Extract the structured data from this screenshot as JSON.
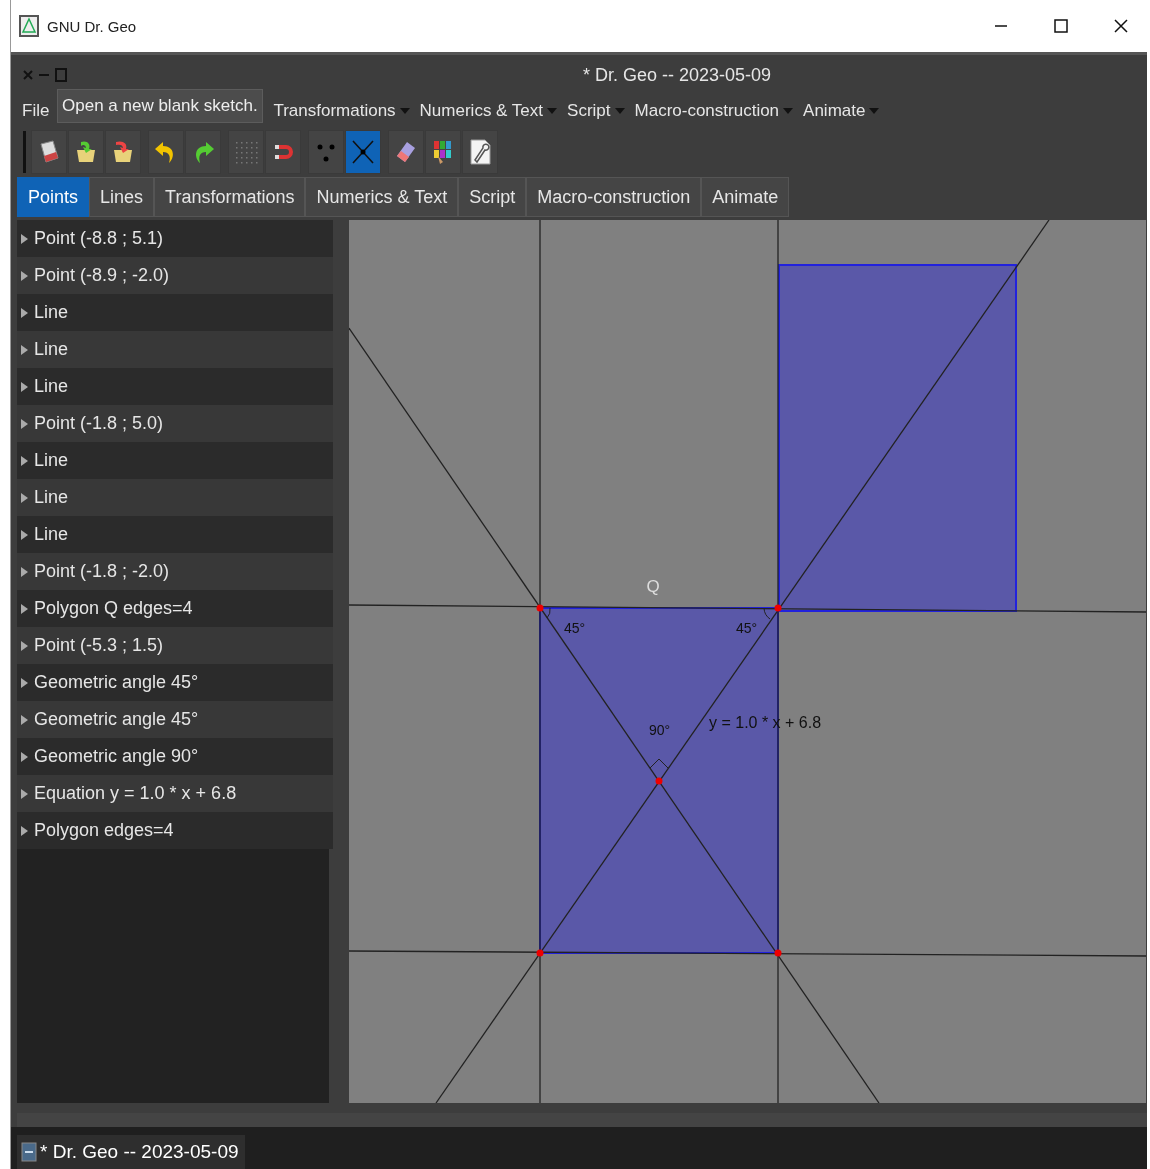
{
  "window": {
    "title": "GNU Dr. Geo"
  },
  "sketch_window": {
    "title": "* Dr. Geo -- 2023-05-09"
  },
  "menu": [
    {
      "label": "File",
      "caret": false
    },
    {
      "label": "Transformations",
      "caret": true
    },
    {
      "label": "Numerics & Text",
      "caret": true
    },
    {
      "label": "Script",
      "caret": true
    },
    {
      "label": "Macro-construction",
      "caret": true
    },
    {
      "label": "Animate",
      "caret": true
    }
  ],
  "tooltip": "Open a new blank sketch.",
  "toolbar": [
    {
      "kind": "new",
      "selected": false
    },
    {
      "kind": "open",
      "selected": false
    },
    {
      "kind": "save",
      "selected": false
    },
    {
      "kind": "undo",
      "selected": false
    },
    {
      "kind": "redo",
      "selected": false
    },
    {
      "kind": "grid",
      "selected": false
    },
    {
      "kind": "magnet",
      "selected": false
    },
    {
      "kind": "points",
      "selected": false
    },
    {
      "kind": "intersection",
      "selected": true
    },
    {
      "kind": "eraser",
      "selected": false
    },
    {
      "kind": "palette",
      "selected": false
    },
    {
      "kind": "wrench",
      "selected": false
    }
  ],
  "tabs": [
    {
      "label": "Points",
      "selected": true
    },
    {
      "label": "Lines",
      "selected": false
    },
    {
      "label": "Transformations",
      "selected": false
    },
    {
      "label": "Numerics & Text",
      "selected": false
    },
    {
      "label": "Script",
      "selected": false
    },
    {
      "label": "Macro-construction",
      "selected": false
    },
    {
      "label": "Animate",
      "selected": false
    }
  ],
  "tree": [
    {
      "label": "Point (-8.8 ; 5.1)",
      "expanded": false
    },
    {
      "label": "Point (-8.9 ; -2.0)",
      "expanded": false
    },
    {
      "label": "Line",
      "expanded": false
    },
    {
      "label": "Line",
      "expanded": false
    },
    {
      "label": "Line",
      "expanded": false
    },
    {
      "label": "Point (-1.8 ; 5.0)",
      "expanded": false
    },
    {
      "label": "Line",
      "expanded": false
    },
    {
      "label": "Line",
      "expanded": false
    },
    {
      "label": "Line",
      "expanded": false
    },
    {
      "label": "Point (-1.8 ; -2.0)",
      "expanded": false
    },
    {
      "label": "Polygon Q edges=4",
      "expanded": false
    },
    {
      "label": "Point (-5.3 ; 1.5)",
      "expanded": false
    },
    {
      "label": "Geometric angle  45°",
      "expanded": false
    },
    {
      "label": "Geometric angle  45°",
      "expanded": false
    },
    {
      "label": "Geometric angle  90°",
      "expanded": false
    },
    {
      "label": "Equation y = 1.0 * x + 6.8",
      "expanded": false
    },
    {
      "label": "Polygon  edges=4",
      "expanded": false
    }
  ],
  "canvas": {
    "polygon_label": "Q",
    "angle_labels": [
      {
        "kind": "left",
        "text": "45°"
      },
      {
        "kind": "right",
        "text": "45°"
      },
      {
        "kind": "bottom",
        "text": "90°"
      }
    ],
    "equation": "y = 1.0 * x + 6.8"
  },
  "taskbar": [
    {
      "label": "* Dr. Geo -- 2023-05-09"
    }
  ]
}
